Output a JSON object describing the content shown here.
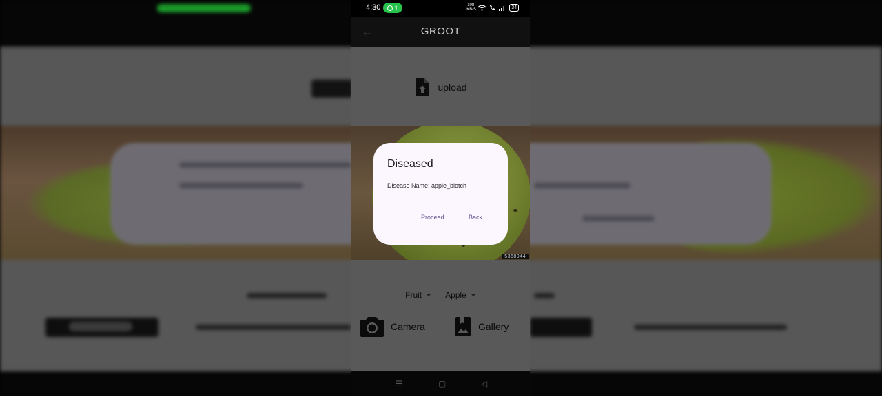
{
  "status_bar": {
    "time": "4:30",
    "hotspot_count": "1",
    "net_speed_value": "108",
    "net_speed_unit": "KB/S",
    "battery": "34"
  },
  "app_bar": {
    "title": "GROOT"
  },
  "upload": {
    "label": "upload"
  },
  "image": {
    "watermark": "5368944"
  },
  "dropdowns": {
    "category": "Fruit",
    "crop": "Apple"
  },
  "actions": {
    "camera_label": "Camera",
    "gallery_label": "Gallery"
  },
  "dialog": {
    "title": "Diseased",
    "body": "Disease Name: apple_blotch",
    "proceed_label": "Proceed",
    "back_label": "Back"
  },
  "nav_bar": {
    "menu_glyph": "☰",
    "home_glyph": "▢",
    "back_glyph": "◁"
  },
  "colors": {
    "dialog_bg": "#fcf7fe",
    "dialog_button": "#5f5690",
    "status_pill": "#27c24c",
    "scrim_content": "#595959"
  }
}
